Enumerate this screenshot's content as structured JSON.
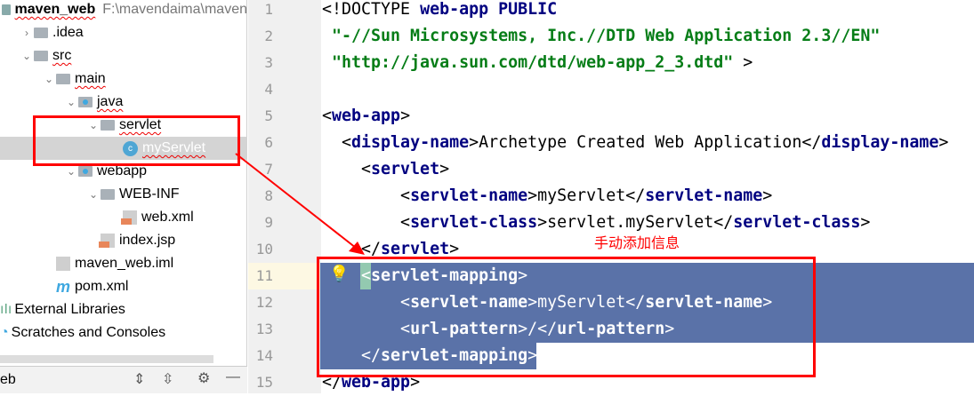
{
  "tree": {
    "project": "maven_web",
    "project_path": "F:\\mavendaima\\maven",
    "items": [
      {
        "label": ".idea",
        "indent": 0,
        "chev": "›",
        "icon": "folder"
      },
      {
        "label": "src",
        "indent": 0,
        "chev": "⌄",
        "icon": "folder"
      },
      {
        "label": "main",
        "indent": 1,
        "chev": "⌄",
        "icon": "folder"
      },
      {
        "label": "java",
        "indent": 2,
        "chev": "⌄",
        "icon": "source-folder"
      },
      {
        "label": "servlet",
        "indent": 3,
        "chev": "⌄",
        "icon": "package"
      },
      {
        "label": "myServlet",
        "indent": 4,
        "chev": "",
        "icon": "class",
        "selected": true
      },
      {
        "label": "webapp",
        "indent": 2,
        "chev": "⌄",
        "icon": "source-folder"
      },
      {
        "label": "WEB-INF",
        "indent": 3,
        "chev": "⌄",
        "icon": "folder"
      },
      {
        "label": "web.xml",
        "indent": 4,
        "chev": "",
        "icon": "xml-file"
      },
      {
        "label": "index.jsp",
        "indent": 3,
        "chev": "",
        "icon": "jsp-file"
      },
      {
        "label": "maven_web.iml",
        "indent": 1,
        "chev": "",
        "icon": "iml-file"
      },
      {
        "label": "pom.xml",
        "indent": 1,
        "chev": "",
        "icon": "maven-file"
      },
      {
        "label": "External Libraries",
        "indent": -1,
        "chev": "",
        "icon": "libraries"
      },
      {
        "label": "Scratches and Consoles",
        "indent": -1,
        "chev": "",
        "icon": "scratches"
      }
    ],
    "toolbar_label": "eb"
  },
  "editor": {
    "lines": [
      [
        [
          "<!DOCTYPE ",
          ""
        ],
        [
          "web-app",
          "k"
        ],
        [
          " PUBLIC",
          "k"
        ]
      ],
      [
        [
          " \"-//Sun Microsystems, Inc.//DTD Web Application 2.3//EN\"",
          "s"
        ]
      ],
      [
        [
          " \"http://java.sun.com/dtd/web-app_2_3.dtd\"",
          "s"
        ],
        [
          " >",
          ""
        ]
      ],
      [],
      [
        [
          "<",
          ""
        ],
        [
          "web-app",
          "t"
        ],
        [
          ">",
          ""
        ]
      ],
      [
        [
          "  <",
          ""
        ],
        [
          "display-name",
          "t"
        ],
        [
          ">Archetype Created Web Application</",
          ""
        ],
        [
          "display-name",
          "t"
        ],
        [
          ">",
          ""
        ]
      ],
      [
        [
          "    <",
          ""
        ],
        [
          "servlet",
          "t"
        ],
        [
          ">",
          ""
        ]
      ],
      [
        [
          "        <",
          ""
        ],
        [
          "servlet-name",
          "t"
        ],
        [
          ">myServlet</",
          ""
        ],
        [
          "servlet-name",
          "t"
        ],
        [
          ">",
          ""
        ]
      ],
      [
        [
          "        <",
          ""
        ],
        [
          "servlet-class",
          "t"
        ],
        [
          ">servlet.myServlet</",
          ""
        ],
        [
          "servlet-class",
          "t"
        ],
        [
          ">",
          ""
        ]
      ],
      [
        [
          "    </",
          ""
        ],
        [
          "servlet",
          "t"
        ],
        [
          ">",
          ""
        ]
      ],
      [
        [
          "    <",
          ""
        ],
        [
          "servlet-mapping",
          "t"
        ],
        [
          ">",
          ""
        ]
      ],
      [
        [
          "        <",
          ""
        ],
        [
          "servlet-name",
          "t"
        ],
        [
          ">myServlet</",
          ""
        ],
        [
          "servlet-name",
          "t"
        ],
        [
          ">",
          ""
        ]
      ],
      [
        [
          "        <",
          ""
        ],
        [
          "url-pattern",
          "t"
        ],
        [
          ">/</",
          ""
        ],
        [
          "url-pattern",
          "t"
        ],
        [
          ">",
          ""
        ]
      ],
      [
        [
          "    </",
          ""
        ],
        [
          "servlet-mapping",
          "t"
        ],
        [
          ">",
          ""
        ]
      ],
      [
        [
          "</",
          ""
        ],
        [
          "web-app",
          "t"
        ],
        [
          ">",
          ""
        ]
      ]
    ],
    "annotation": "手动添加信息",
    "selection_color": "#5a72a8"
  }
}
